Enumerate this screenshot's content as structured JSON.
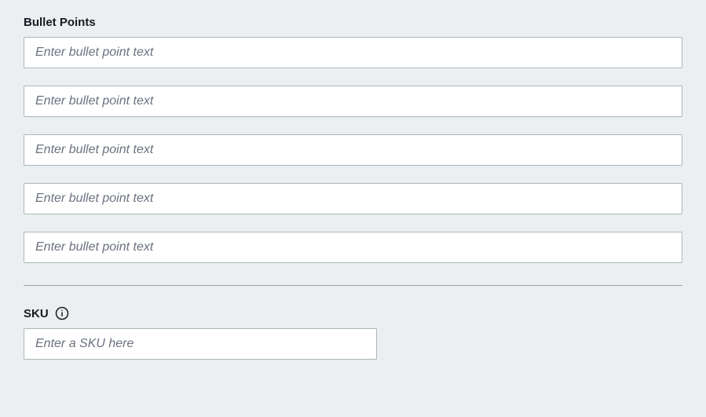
{
  "bullet_points": {
    "label": "Bullet Points",
    "items": [
      {
        "placeholder": "Enter bullet point text",
        "value": ""
      },
      {
        "placeholder": "Enter bullet point text",
        "value": ""
      },
      {
        "placeholder": "Enter bullet point text",
        "value": ""
      },
      {
        "placeholder": "Enter bullet point text",
        "value": ""
      },
      {
        "placeholder": "Enter bullet point text",
        "value": ""
      }
    ]
  },
  "sku": {
    "label": "SKU",
    "placeholder": "Enter a SKU here",
    "value": ""
  }
}
